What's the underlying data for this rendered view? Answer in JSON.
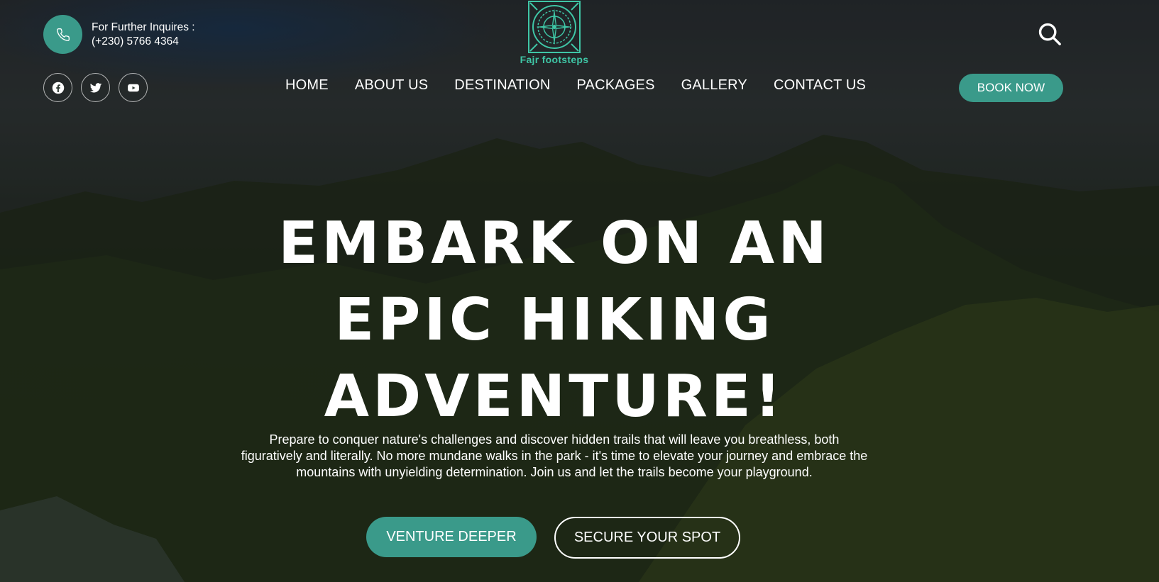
{
  "header": {
    "contact_label": "For Further Inquires :",
    "contact_phone": "(+230) 5766 4364",
    "logo_text": "Fajr footsteps",
    "book_label": "BOOK NOW"
  },
  "nav": {
    "items": [
      {
        "label": "HOME"
      },
      {
        "label": "ABOUT US"
      },
      {
        "label": "DESTINATION"
      },
      {
        "label": "PACKAGES"
      },
      {
        "label": "GALLERY"
      },
      {
        "label": "CONTACT US"
      }
    ]
  },
  "socials": [
    {
      "icon": "facebook-icon"
    },
    {
      "icon": "twitter-icon"
    },
    {
      "icon": "youtube-icon"
    }
  ],
  "hero": {
    "headline_line1": "EMBARK ON AN",
    "headline_line2": "EPIC HIKING",
    "headline_line3": "ADVENTURE!",
    "subtext": "Prepare to conquer nature's challenges and discover hidden trails that will leave you breathless, both figuratively and literally. No more mundane walks in the park - it's time to elevate your journey and embrace the mountains with unyielding determination. Join us and let the trails become your playground.",
    "primary_cta": "VENTURE DEEPER",
    "secondary_cta": "SECURE YOUR SPOT"
  },
  "colors": {
    "accent": "#3a9a8a",
    "logo": "#3fc6a6"
  }
}
